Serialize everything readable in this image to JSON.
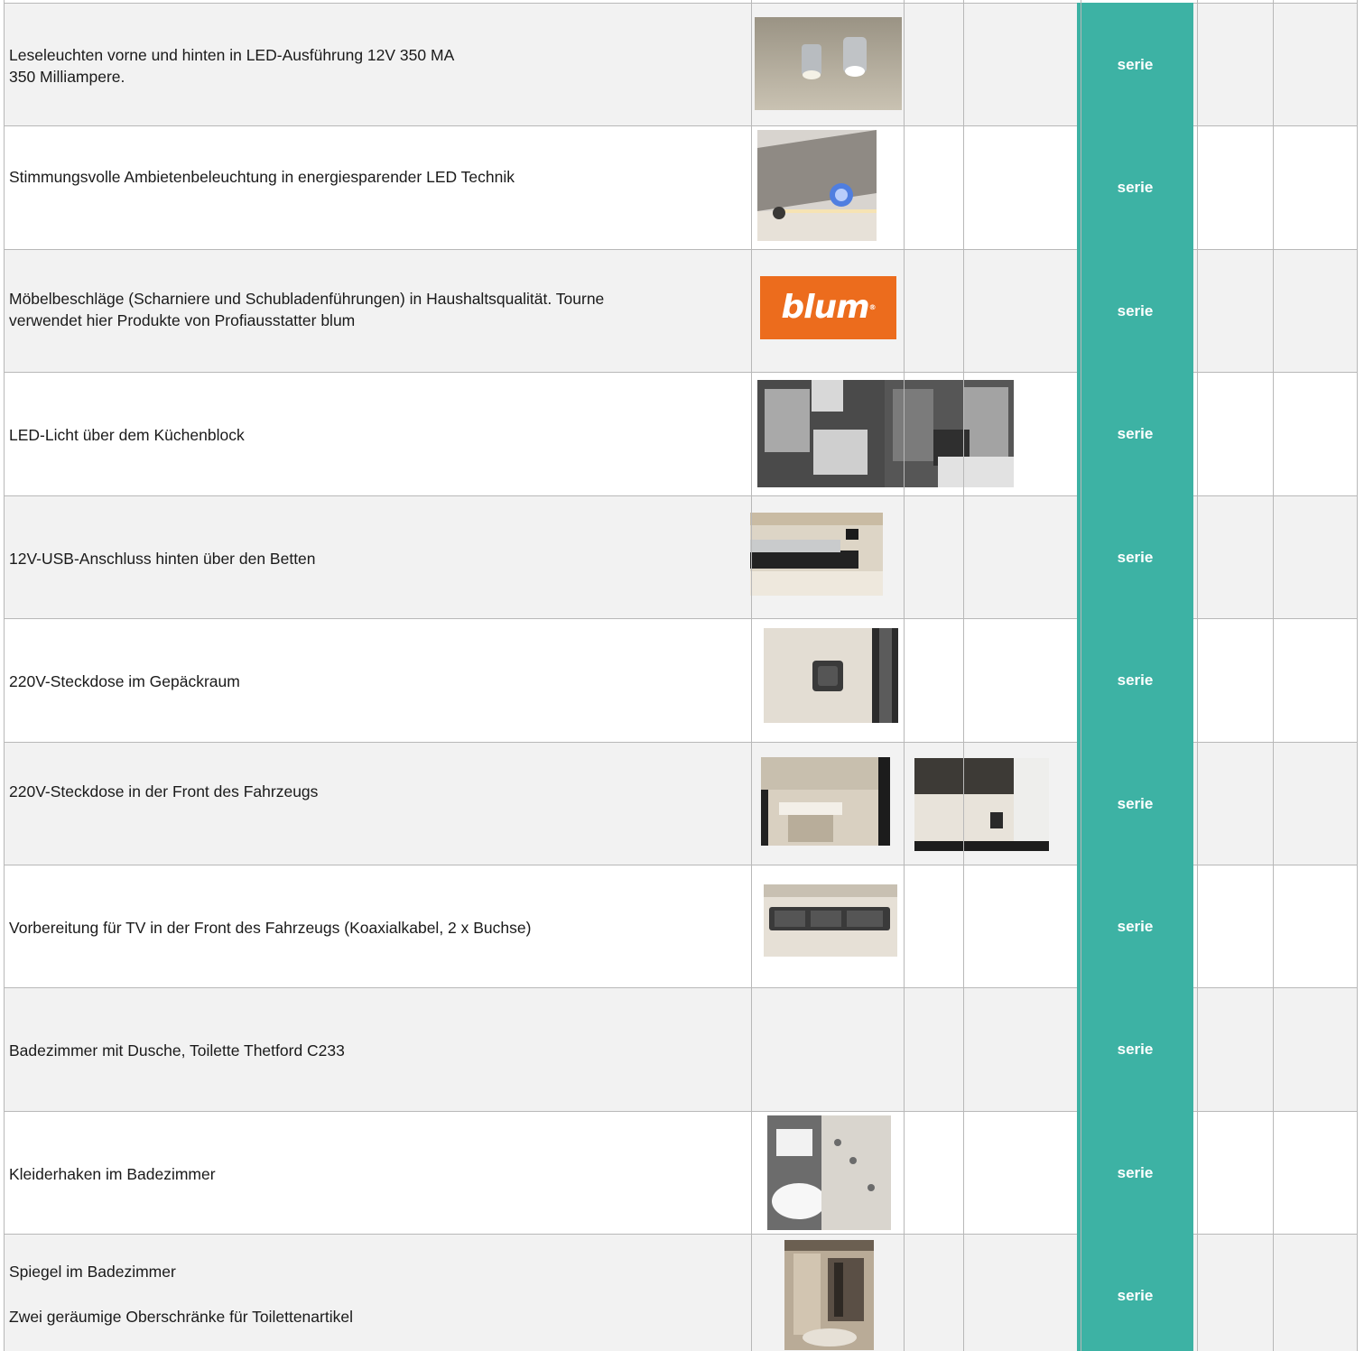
{
  "rows": [
    {
      "text": "Leseleuchten vorne und hinten in LED-Ausführung 12V  350 MA\n350 Milliampere.",
      "status": "serie"
    },
    {
      "text": "Stimmungsvolle Ambietenbeleuchtung in energiesparender LED Technik",
      "status": "serie"
    },
    {
      "text": "Möbelbeschläge (Scharniere und Schubladenführungen) in Haushaltsqualität. Tourne\nverwendet hier Produkte von Profiausstatter blum",
      "status": "serie",
      "logo": "blum"
    },
    {
      "text": "LED-Licht über dem Küchenblock",
      "status": "serie"
    },
    {
      "text": "12V-USB-Anschluss hinten über den Betten",
      "status": "serie"
    },
    {
      "text": "220V-Steckdose im Gepäckraum",
      "status": "serie"
    },
    {
      "text": "220V-Steckdose in der Front des Fahrzeugs",
      "status": "serie"
    },
    {
      "text": "Vorbereitung für TV in der Front des Fahrzeugs (Koaxialkabel, 2 x Buchse)",
      "status": "serie"
    },
    {
      "text": "Badezimmer mit Dusche, Toilette Thetford C233",
      "status": "serie"
    },
    {
      "text": "Kleiderhaken im Badezimmer",
      "status": "serie"
    },
    {
      "text": "Spiegel im Badezimmer",
      "text2": "Zwei geräumige Oberschränke für Toilettenartikel",
      "status": "serie"
    }
  ],
  "colors": {
    "serie": "#3db2a4",
    "alt_row": "#f2f2f2",
    "grid": "#b8b8b8"
  }
}
